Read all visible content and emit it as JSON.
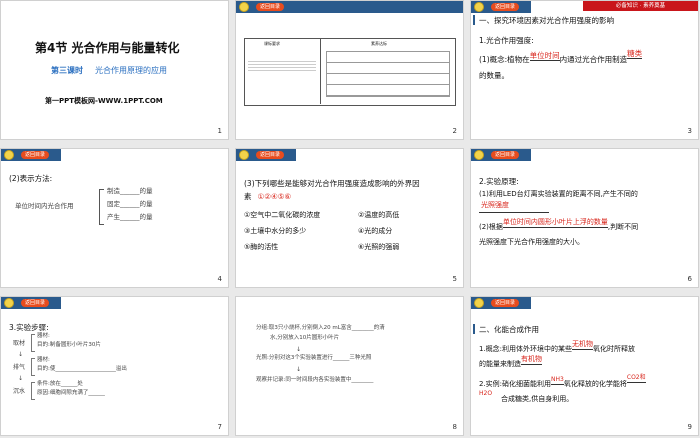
{
  "common": {
    "return_btn": "返回目录"
  },
  "s1": {
    "title": "第4节  光合作用与能量转化",
    "sub_a": "第三课时",
    "sub_b": "光合作用原理的应用",
    "site": "第一PPT模板网-WWW.1PPT.COM",
    "num": "1"
  },
  "s2": {
    "col1": "课标要求",
    "col2": "素养达标",
    "num": "2"
  },
  "s3": {
    "ribbon": "必备知识 · 素养奠基",
    "h1": "一、探究环境因素对光合作用强度的影响",
    "h2": "1.光合作用强度:",
    "l1a": "(1)概念:植物在",
    "ans1": "单位时间",
    "l1b": "内通过光合作用制造",
    "ans2": "糖类",
    "l2": "的数量。",
    "num": "3"
  },
  "s4": {
    "head": "(2)表示方法:",
    "left": "单位时间内光合作用",
    "r1": "制造______的量",
    "r2": "固定______的量",
    "r3": "产生______的量",
    "num": "4"
  },
  "s5": {
    "q1": "(3)下列哪些是能够对光合作用强度造成影响的外界因",
    "q2": "素",
    "ans": "①②④⑤⑥",
    "o1": "①空气中二氧化碳的浓度",
    "o2": "②温度的高低",
    "o3": "③土壤中水分的多少",
    "o4": "④光的成分",
    "o5": "⑤酶的活性",
    "o6": "⑥光照的强弱",
    "num": "5"
  },
  "s6": {
    "h": "2.实验原理:",
    "l1": "(1)利用LED台灯离实验装置的距离不同,产生不同的",
    "a1": "光照强度",
    "l3a": "(2)根据",
    "a2": "单位时间内圆形小叶片上浮的数量",
    "l3b": ",判断不同",
    "l4": "光照强度下光合作用强度的大小。",
    "num": "6"
  },
  "s7": {
    "h": "3.实验步骤:",
    "k1": "取材",
    "k2": "排气",
    "k3": "沉水",
    "r1": "器材:",
    "r2": "目的:制备圆形小叶片30片",
    "r3": "器材:",
    "r4": "目的:使______________________溢出",
    "r5": "条件:放在______处",
    "r6": "原因:细胞间隙充满了______",
    "num": "7"
  },
  "s8": {
    "a1": "分组:取3只小烧杯,分别倒入20 mL富含________的清",
    "a2": "水,分别放入10片圆形小叶片",
    "b1": "光照:分别对这3个实验装置进行______三种光照",
    "c1": "观察并记录:同一时间段内各实验装置中________",
    "num": "8"
  },
  "s9": {
    "h": "二、化能合成作用",
    "l1a": "1.概念:利用体外环境中的某些",
    "a1": "无机物",
    "l1b": "氧化时所释放",
    "l2a": "的能量来制造",
    "a2": "有机物",
    "l3a": "2.实例:硝化细菌能利用",
    "a3": "NH3",
    "l3b": "氧化释放的化学能将",
    "a4": "CO2和",
    "a5": "H2O",
    "l4": "合成糖类,供自身利用。",
    "num": "9"
  }
}
